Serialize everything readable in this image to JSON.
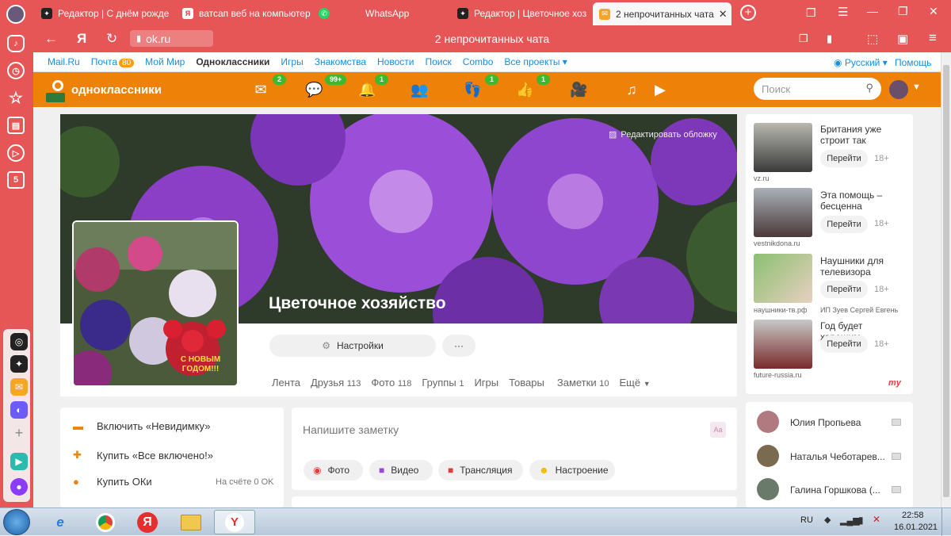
{
  "tabs": [
    {
      "label": "Редактор | С днём рожде",
      "icon": "ok-editor-icon"
    },
    {
      "label": "ватсап веб на компьютер",
      "icon": "yandex-search-icon"
    },
    {
      "label": "WhatsApp",
      "icon": "whatsapp-icon"
    },
    {
      "label": "Редактор | Цветочное хоз",
      "icon": "ok-editor-icon"
    },
    {
      "label": "2 непрочитанных чата",
      "icon": "mail-icon"
    }
  ],
  "address": {
    "back_icon": "←",
    "yandex_logo": "Я",
    "refresh_icon": "↻",
    "url": "ok.ru",
    "page_title": "2 непрочитанных чата"
  },
  "mailru_bar": {
    "links": [
      "Mail.Ru",
      "Почта",
      "Мой Мир",
      "Одноклассники",
      "Игры",
      "Знакомства",
      "Новости",
      "Поиск",
      "Combo",
      "Все проекты"
    ],
    "mail_badge": "80",
    "dropdown_arrow": "▾",
    "language": "Русский",
    "help": "Помощь"
  },
  "ok_header": {
    "logo_text": "одноклассники",
    "search_placeholder": "Поиск",
    "counters": {
      "messages": "2",
      "discussions": "99+",
      "notifications": "1",
      "guests": "1",
      "events": "1"
    }
  },
  "cover": {
    "edit_label": "Редактировать обложку"
  },
  "avatar": {
    "holiday_text": "С НОВЫМ ГОДОМ!!!"
  },
  "group": {
    "name": "Цветочное хозяйство",
    "settings_label": "Настройки",
    "more_label": "···",
    "nav": [
      {
        "label": "Лента",
        "count": ""
      },
      {
        "label": "Друзья",
        "count": "113"
      },
      {
        "label": "Фото",
        "count": "118"
      },
      {
        "label": "Группы",
        "count": "1"
      },
      {
        "label": "Игры",
        "count": ""
      },
      {
        "label": "Товары",
        "count": ""
      },
      {
        "label": "Заметки",
        "count": "10"
      },
      {
        "label": "Ещё",
        "count": ""
      }
    ]
  },
  "left_panel": {
    "invisible": "Включить «Невидимку»",
    "all_inclusive": "Купить «Все включено!»",
    "buy_ok": "Купить ОКи",
    "balance": "На счёте 0 OK"
  },
  "composer": {
    "placeholder": "Напишите заметку",
    "buttons": [
      "Фото",
      "Видео",
      "Трансляция",
      "Настроение"
    ]
  },
  "ads": [
    {
      "title": "Британия уже строит так",
      "source": "vz.ru",
      "button": "Перейти",
      "age": "18+"
    },
    {
      "title": "Эта помощь – бесценна",
      "source": "vestnikdona.ru",
      "button": "Перейти",
      "age": "18+"
    },
    {
      "title": "Наушники для телевизора",
      "source": "наушники-тв.рф",
      "source2": "ИП Зуев Сергей Евгень",
      "button": "Перейти",
      "age": "18+"
    },
    {
      "title": "Год будет хорошим",
      "source": "future-russia.ru",
      "button": "Перейти",
      "age": "18+"
    }
  ],
  "ads_brand": "my",
  "friends": [
    {
      "name": "Юлия Пропьева"
    },
    {
      "name": "Наталья Чеботарев..."
    },
    {
      "name": "Галина Горшкова (..."
    }
  ],
  "taskbar": {
    "lang": "RU",
    "time": "22:58",
    "date": "16.01.2021",
    "yandex_letter": "Я",
    "browser_letter": "Y",
    "ie_letter": "e"
  },
  "sidebar_icon_label": "5"
}
